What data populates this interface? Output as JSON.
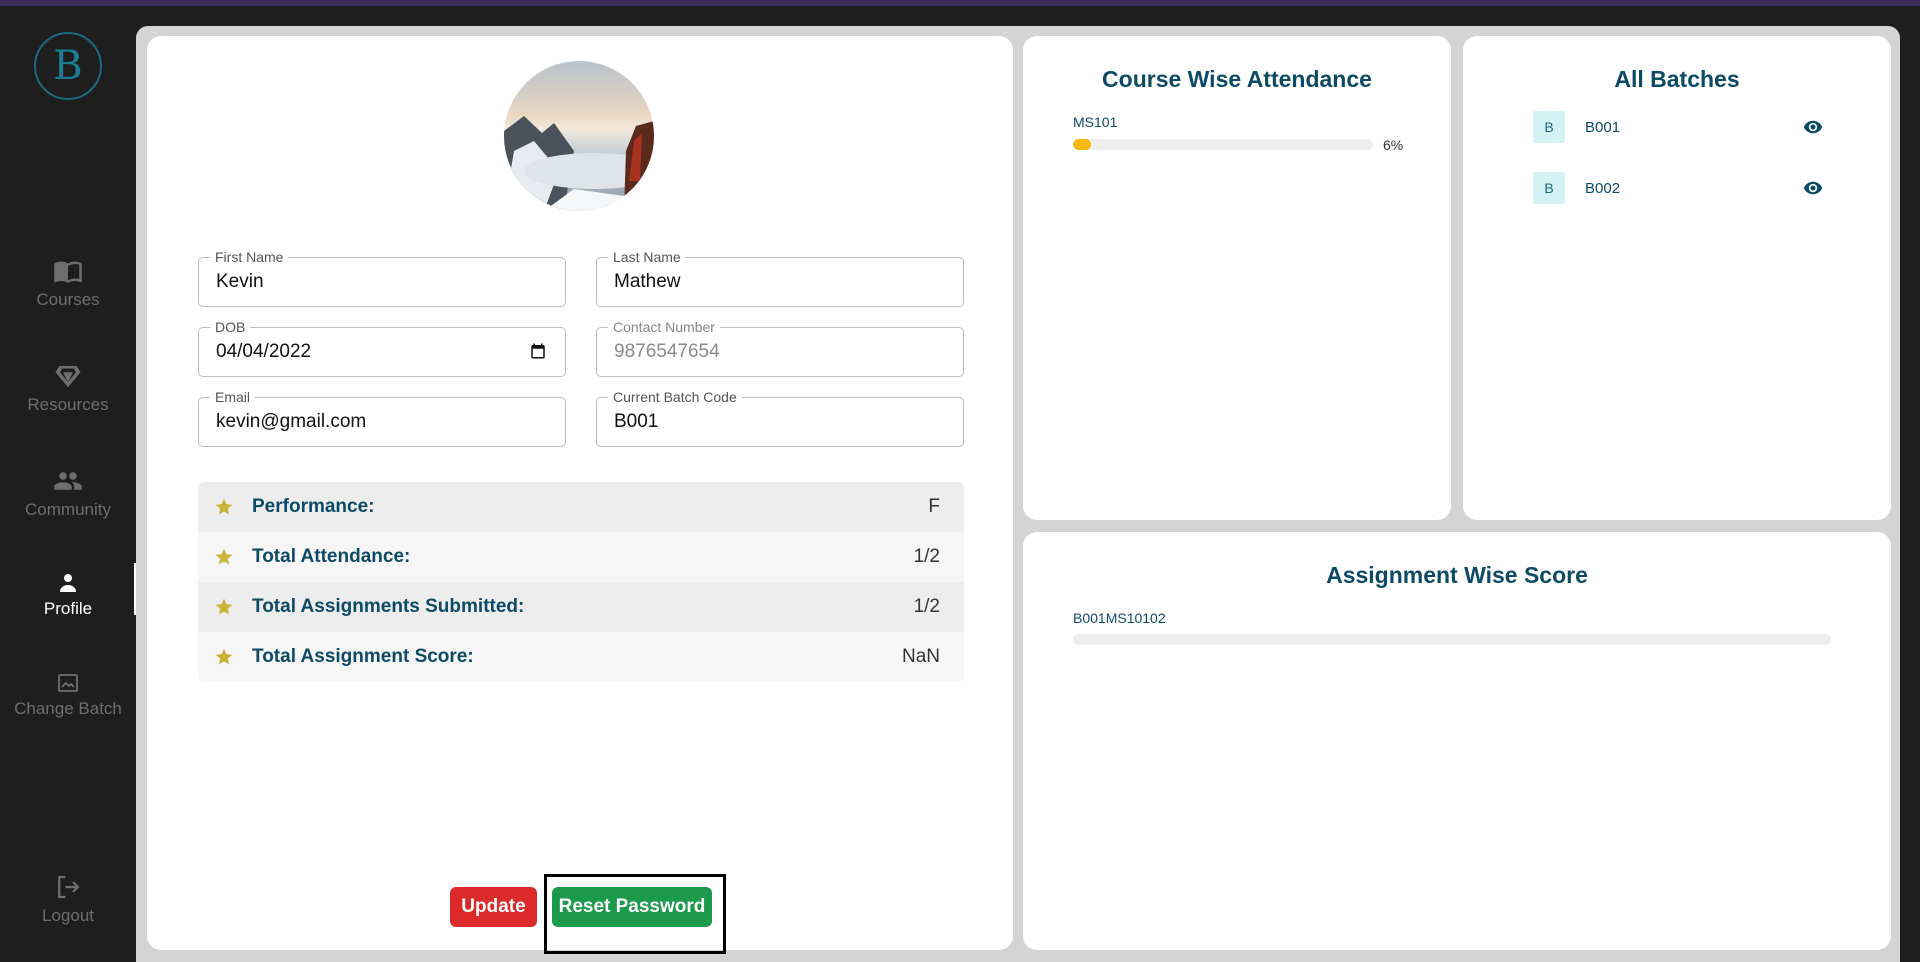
{
  "sidebar": {
    "logo_letter": "B",
    "items": [
      {
        "label": "Courses",
        "icon": "book-icon"
      },
      {
        "label": "Resources",
        "icon": "gem-icon"
      },
      {
        "label": "Community",
        "icon": "people-icon"
      },
      {
        "label": "Profile",
        "icon": "person-icon",
        "active": true
      },
      {
        "label": "Change Batch",
        "icon": "image-icon"
      },
      {
        "label": "Logout",
        "icon": "logout-icon"
      }
    ]
  },
  "profile": {
    "fields": {
      "first_name": {
        "label": "First Name",
        "value": "Kevin"
      },
      "last_name": {
        "label": "Last Name",
        "value": "Mathew"
      },
      "dob": {
        "label": "DOB",
        "value": "04/04/2022"
      },
      "contact": {
        "label": "Contact Number",
        "value": "9876547654"
      },
      "email": {
        "label": "Email",
        "value": "kevin@gmail.com"
      },
      "batch_code": {
        "label": "Current Batch Code",
        "value": "B001"
      }
    },
    "stats": [
      {
        "label": "Performance:",
        "value": "F"
      },
      {
        "label": "Total Attendance:",
        "value": "1/2"
      },
      {
        "label": "Total Assignments Submitted:",
        "value": "1/2"
      },
      {
        "label": "Total Assignment Score:",
        "value": "NaN"
      }
    ],
    "update_label": "Update",
    "reset_label": "Reset Password"
  },
  "attendance": {
    "title": "Course Wise Attendance",
    "items": [
      {
        "course": "MS101",
        "percent": 6,
        "percent_label": "6%"
      }
    ]
  },
  "batches": {
    "title": "All Batches",
    "items": [
      {
        "badge": "B",
        "name": "B001"
      },
      {
        "badge": "B",
        "name": "B002"
      }
    ]
  },
  "assignments": {
    "title": "Assignment Wise Score",
    "items": [
      {
        "name": "B001MS10102",
        "score_fraction": 0
      }
    ]
  },
  "colors": {
    "accent": "#0d4a66",
    "update": "#dc2a2a",
    "reset": "#1a9a4a",
    "progress": "#f5b90f"
  }
}
